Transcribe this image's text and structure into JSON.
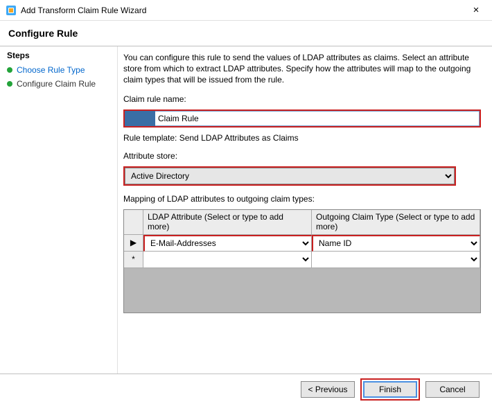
{
  "window": {
    "title": "Add Transform Claim Rule Wizard"
  },
  "header": {
    "title": "Configure Rule"
  },
  "sidebar": {
    "title": "Steps",
    "items": [
      {
        "label": "Choose Rule Type"
      },
      {
        "label": "Configure Claim Rule"
      }
    ]
  },
  "main": {
    "description": "You can configure this rule to send the values of LDAP attributes as claims. Select an attribute store from which to extract LDAP attributes. Specify how the attributes will map to the outgoing claim types that will be issued from the rule.",
    "ruleNameLabel": "Claim rule name:",
    "ruleNameValue": "Claim Rule",
    "templateText": "Rule template: Send LDAP Attributes as Claims",
    "attrStoreLabel": "Attribute store:",
    "attrStoreValue": "Active Directory",
    "mappingLabel": "Mapping of LDAP attributes to outgoing claim types:",
    "mapHeaders": {
      "ldap": "LDAP Attribute (Select or type to add more)",
      "claim": "Outgoing Claim Type (Select or type to add more)"
    },
    "mapRows": [
      {
        "marker": "▶",
        "ldap": "E-Mail-Addresses",
        "claim": "Name ID"
      },
      {
        "marker": "*",
        "ldap": "",
        "claim": ""
      }
    ]
  },
  "footer": {
    "prev": "< Previous",
    "finish": "Finish",
    "cancel": "Cancel"
  }
}
